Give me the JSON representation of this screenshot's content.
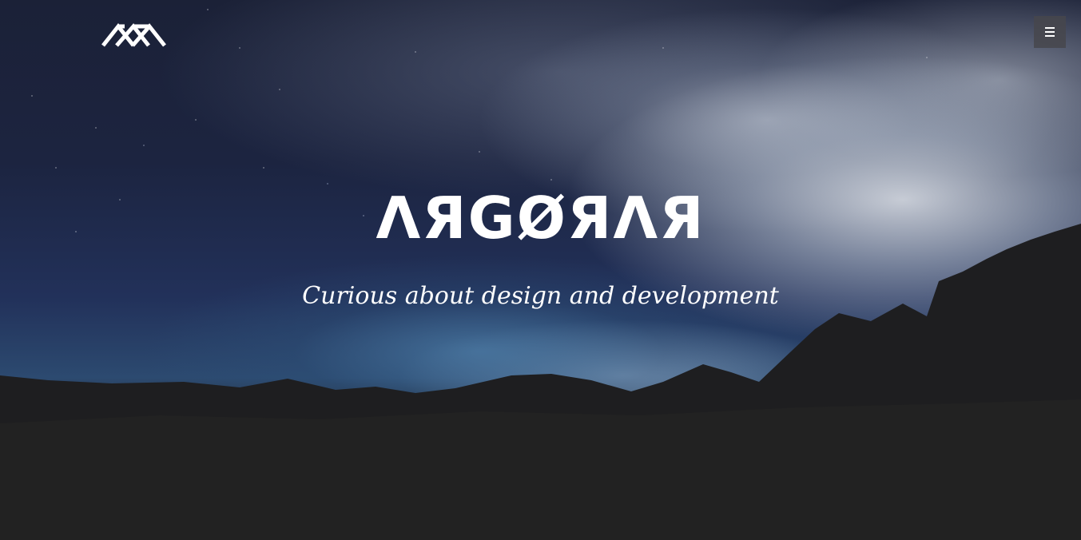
{
  "header": {
    "logo_icon": "mountain-peaks-logo-icon",
    "menu_icon": "hamburger-menu-icon"
  },
  "hero": {
    "title": "ΛЯGØЯΛЯ",
    "tagline": "Curious about design and development"
  },
  "colors": {
    "background": "#222222",
    "text": "#ffffff",
    "menu_button": "#46464c"
  }
}
